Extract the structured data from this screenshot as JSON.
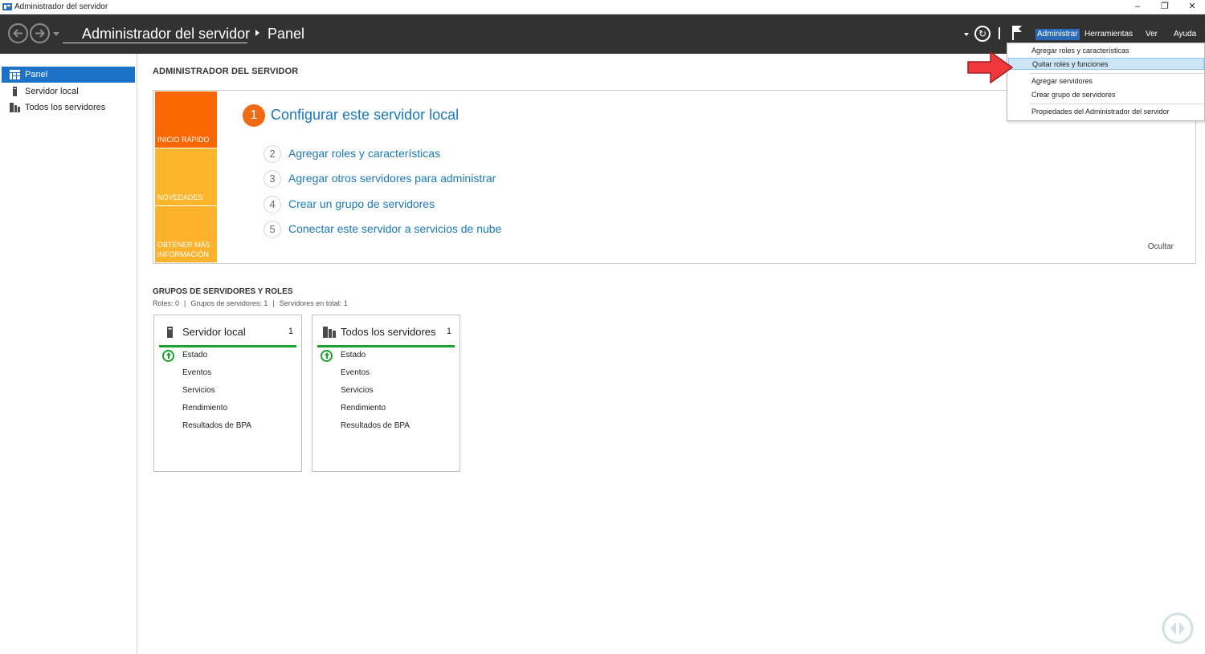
{
  "window": {
    "title": "Administrador del servidor",
    "controls": {
      "minimize": "–",
      "restore": "❐",
      "close": "✕"
    }
  },
  "header": {
    "breadcrumb_app": "Administrador del servidor",
    "breadcrumb_page": "Panel",
    "menu": [
      "Administrar",
      "Herramientas",
      "Ver",
      "Ayuda"
    ],
    "active_menu": "Administrar"
  },
  "sidebar": {
    "items": [
      {
        "label": "Panel",
        "icon": "dashboard-icon",
        "selected": true
      },
      {
        "label": "Servidor local",
        "icon": "server-icon",
        "selected": false
      },
      {
        "label": "Todos los servidores",
        "icon": "servers-icon",
        "selected": false
      }
    ]
  },
  "main": {
    "heading": "ADMINISTRADOR DEL SERVIDOR",
    "welcome": {
      "tiles": [
        "INICIO RÁPIDO",
        "NOVEDADES",
        "OBTENER MÁS INFORMACIÓN"
      ],
      "main_step": {
        "number": "1",
        "text": "Configurar este servidor local"
      },
      "steps": [
        {
          "number": "2",
          "text": "Agregar roles y características"
        },
        {
          "number": "3",
          "text": "Agregar otros servidores para administrar"
        },
        {
          "number": "4",
          "text": "Crear un grupo de servidores"
        },
        {
          "number": "5",
          "text": "Conectar este servidor a servicios de nube"
        }
      ],
      "hide_label": "Ocultar"
    },
    "groups": {
      "title": "GRUPOS DE SERVIDORES Y ROLES",
      "summary": [
        "Roles: 0",
        "Grupos de servidores: 1",
        "Servidores en total: 1"
      ],
      "cards": [
        {
          "title": "Servidor local",
          "count": "1",
          "rows": [
            "Estado",
            "Eventos",
            "Servicios",
            "Rendimiento",
            "Resultados de BPA"
          ]
        },
        {
          "title": "Todos los servidores",
          "count": "1",
          "rows": [
            "Estado",
            "Eventos",
            "Servicios",
            "Rendimiento",
            "Resultados de BPA"
          ]
        }
      ]
    }
  },
  "dropdown": {
    "items": [
      "Agregar roles y características",
      "Quitar roles y funciones",
      "Agregar servidores",
      "Crear grupo de servidores",
      "Propiedades del Administrador del servidor"
    ],
    "highlighted": "Quitar roles y funciones"
  },
  "colors": {
    "header_bg": "#323232",
    "accent_blue": "#1c72c6",
    "link_blue": "#1a79b9",
    "tile_orange": "#fa6700",
    "tile_yellow": "#fdb52c",
    "status_green": "#1aa32c",
    "pointer_red": "#f0383c"
  }
}
